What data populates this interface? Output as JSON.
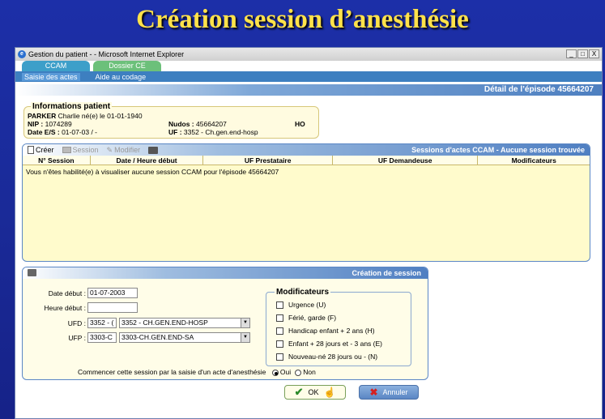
{
  "slide": {
    "title": "Création session d’anesthésie"
  },
  "window": {
    "title": "Gestion du patient - - Microsoft Internet Explorer",
    "min": "_",
    "max": "□",
    "close": "X"
  },
  "tabs": [
    {
      "label": "CCAM"
    },
    {
      "label": "Dossier CE"
    }
  ],
  "subnav": [
    {
      "label": "Saisie des actes"
    },
    {
      "label": "Aide au codage"
    }
  ],
  "episode": {
    "label": "Détail de l’épisode 45664207"
  },
  "patient": {
    "legend": "Informations patient",
    "name_label": "PARKER",
    "name_value": "Charlie né(e) le 01-01-1940",
    "nip_label": "NIP :",
    "nip_value": "1074289",
    "nudos_label": "Nudos :",
    "nudos_value": "45664207",
    "ho": "HO",
    "date_label": "Date E/S :",
    "date_value": "01-07-03 / -",
    "uf_label": "UF :",
    "uf_value": "3352 - Ch.gen.end-hosp"
  },
  "sessions": {
    "toolbar": {
      "create": "Créer",
      "session": "Session",
      "modify": "Modifier"
    },
    "title": "Sessions d'actes CCAM - Aucune session trouvée",
    "columns": [
      "N° Session",
      "Date / Heure début",
      "UF Prestataire",
      "UF Demandeuse",
      "Modificateurs"
    ],
    "notice": "Vous n'êtes habilité(e) à visualiser aucune session CCAM pour l'épisode 45664207"
  },
  "creation": {
    "title": "Création de session",
    "date_label": "Date début :",
    "date_value": "01-07-2003",
    "heure_label": "Heure début :",
    "heure_value": "",
    "ufd_label": "UFD :",
    "ufd_code": "3352 - (",
    "ufd_select": "3352 - CH.GEN.END-HOSP",
    "ufp_label": "UFP :",
    "ufp_code": "3303-C",
    "ufp_select": "3303-CH.GEN.END-SA",
    "mods_legend": "Modificateurs",
    "mods": [
      {
        "label": "Urgence (U)"
      },
      {
        "label": "Férié, garde (F)"
      },
      {
        "label": "Handicap enfant + 2 ans (H)"
      },
      {
        "label": "Enfant  + 28 jours et - 3 ans (E)"
      },
      {
        "label": "Nouveau-né  28 jours ou - (N)"
      }
    ],
    "question": "Commencer cette session par la saisie d'un acte d'anesthésie",
    "oui": "Oui",
    "non": "Non"
  },
  "buttons": {
    "ok": "OK",
    "cancel": "Annuler"
  }
}
